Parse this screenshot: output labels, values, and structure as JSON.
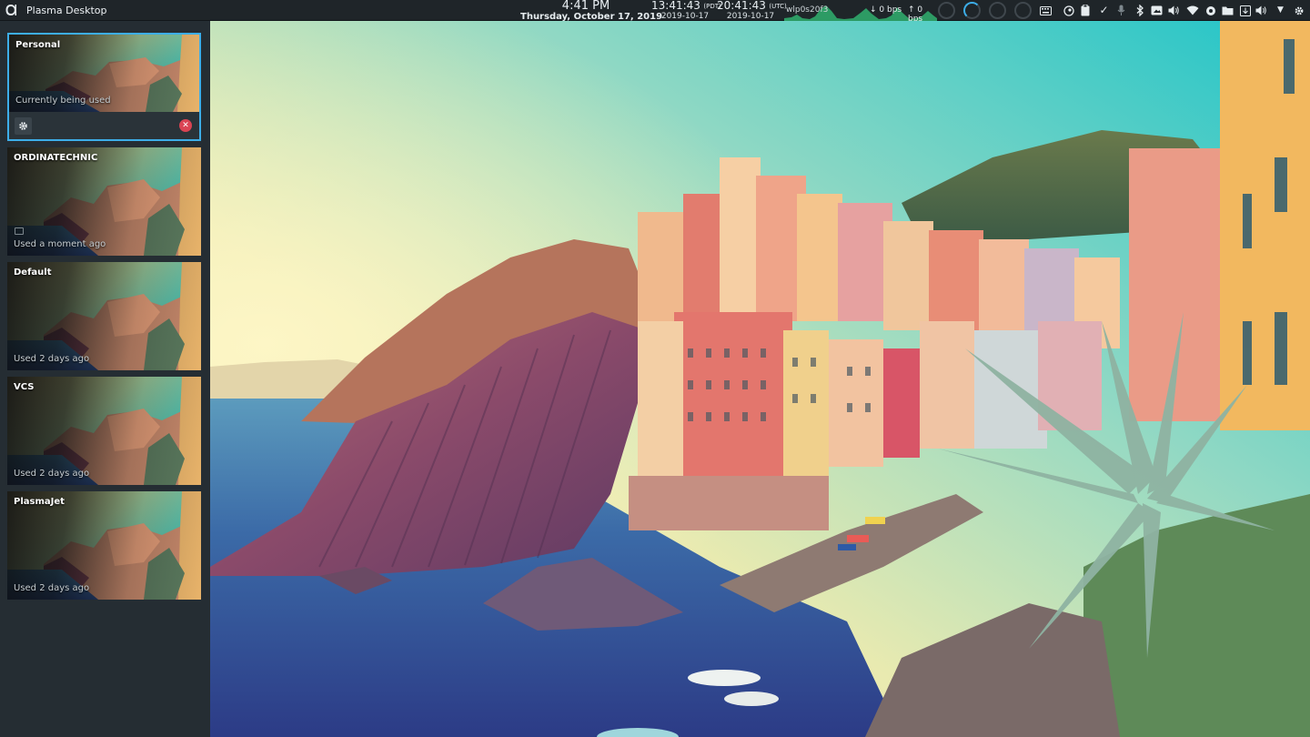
{
  "panel": {
    "window_title": "Plasma Desktop",
    "clock": {
      "time": "4:41 PM",
      "date": "Thursday, October 17, 2019"
    },
    "clock_pdt": {
      "time": "13:41:43",
      "zone": "(PDT)",
      "date": "2019-10-17"
    },
    "clock_utc": {
      "time": "20:41:43",
      "zone": "(UTC)",
      "date": "2019-10-17"
    },
    "network": {
      "interface": "wlp0s20f3",
      "down_rate": "0 bps",
      "up_rate": "0 bps"
    },
    "tray_icons": [
      "keyboard-icon",
      "steam-icon",
      "clipboard-icon",
      "checkmark-icon",
      "microphone-icon",
      "bluetooth-icon",
      "media-icon",
      "volume-icon",
      "wifi-icon",
      "vault-icon",
      "folder-icon",
      "update-icon",
      "volume-icon",
      "expand-arrow-icon",
      "settings-icon"
    ]
  },
  "activities": [
    {
      "name": "Personal",
      "status": "Currently being used",
      "current": true
    },
    {
      "name": "ORDINATECHNIC",
      "status": "Used a moment ago",
      "current": false
    },
    {
      "name": "Default",
      "status": "Used 2 days ago",
      "current": false
    },
    {
      "name": "VCS",
      "status": "Used 2 days ago",
      "current": false
    },
    {
      "name": "PlasmaJet",
      "status": "Used 2 days ago",
      "current": false
    }
  ],
  "colors": {
    "accent": "#3daee9",
    "panel_bg": "#1f2529",
    "sidebar_bg": "#252d33",
    "stop_button": "#da4453",
    "network_graph": "#2fa86a"
  }
}
